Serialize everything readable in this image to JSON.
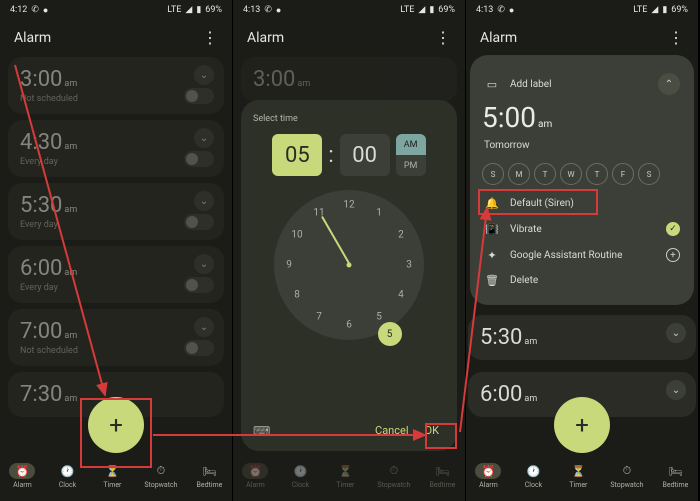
{
  "statusbar": {
    "time1": "4:12",
    "time2": "4:13",
    "time3": "4:13",
    "net": "LTE",
    "batt": "69%"
  },
  "title": "Alarm",
  "nav": {
    "alarm": "Alarm",
    "clock": "Clock",
    "timer": "Timer",
    "stopwatch": "Stopwatch",
    "bedtime": "Bedtime"
  },
  "screen1": {
    "alarms": [
      {
        "time": "3:00",
        "ampm": "am",
        "sub": "Not scheduled"
      },
      {
        "time": "4:30",
        "ampm": "am",
        "sub": "Every day"
      },
      {
        "time": "5:30",
        "ampm": "am",
        "sub": "Every day"
      },
      {
        "time": "6:00",
        "ampm": "am",
        "sub": "Every day"
      },
      {
        "time": "7:00",
        "ampm": "am",
        "sub": "Not scheduled"
      },
      {
        "time": "7:30",
        "ampm": "am",
        "sub": ""
      }
    ]
  },
  "screen2": {
    "bg_time": "3:00",
    "bg_ampm": "am",
    "label": "Select time",
    "hour": "05",
    "minute": "00",
    "am": "AM",
    "pm": "PM",
    "cancel": "Cancel",
    "ok": "OK",
    "clock_nums": [
      "12",
      "1",
      "2",
      "3",
      "4",
      "5",
      "6",
      "7",
      "8",
      "9",
      "10",
      "11"
    ],
    "selected": "5"
  },
  "screen3": {
    "add_label": "Add label",
    "time": "5:00",
    "ampm": "am",
    "tomorrow": "Tomorrow",
    "days": [
      "S",
      "M",
      "T",
      "W",
      "T",
      "F",
      "S"
    ],
    "ringtone": "Default (Siren)",
    "vibrate": "Vibrate",
    "routine": "Google Assistant Routine",
    "delete": "Delete",
    "below": [
      {
        "time": "5:30",
        "ampm": "am"
      },
      {
        "time": "6:00",
        "ampm": "am"
      }
    ]
  }
}
